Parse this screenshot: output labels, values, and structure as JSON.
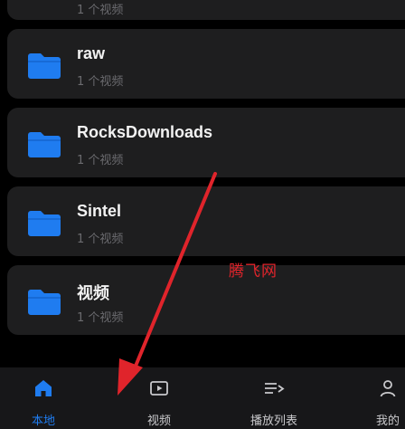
{
  "folders": [
    {
      "name": "",
      "count": "1 个视频"
    },
    {
      "name": "raw",
      "count": "1 个视频"
    },
    {
      "name": "RocksDownloads",
      "count": "1 个视频"
    },
    {
      "name": "Sintel",
      "count": "1 个视频"
    },
    {
      "name": "视频",
      "count": "1 个视频"
    }
  ],
  "tabs": [
    {
      "label": "本地",
      "icon": "home-icon",
      "active": true
    },
    {
      "label": "视频",
      "icon": "play-box-icon",
      "active": false
    },
    {
      "label": "播放列表",
      "icon": "playlist-icon",
      "active": false
    },
    {
      "label": "我的",
      "icon": "person-icon",
      "active": false
    }
  ],
  "watermark": "腾飞网",
  "colors": {
    "accent": "#1f7cf0",
    "folder": "#1f7cf0",
    "arrow": "#e0242b",
    "card": "#1e1e1f"
  }
}
